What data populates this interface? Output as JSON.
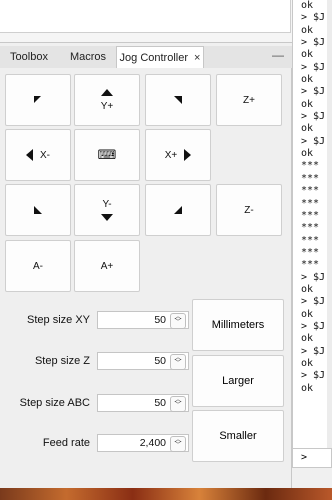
{
  "tabs": [
    {
      "label": "Toolbox"
    },
    {
      "label": "Macros"
    },
    {
      "label": "Jog Controller",
      "close": "×"
    }
  ],
  "minimize_glyph": "—",
  "jog": {
    "y_plus": "Y+",
    "z_plus": "Z+",
    "x_minus": "X-",
    "x_plus": "X+",
    "y_minus": "Y-",
    "z_minus": "Z-",
    "a_minus": "A-",
    "a_plus": "A+",
    "keyboard_glyph": "⌨"
  },
  "fields": [
    {
      "label": "Step size XY",
      "value": "50"
    },
    {
      "label": "Step size Z",
      "value": "50"
    },
    {
      "label": "Step size ABC",
      "value": "50"
    },
    {
      "label": "Feed rate",
      "value": "2,400"
    }
  ],
  "side_buttons": {
    "units": "Millimeters",
    "larger": "Larger",
    "smaller": "Smaller"
  },
  "console": {
    "lines": [
      "ok",
      "> $J",
      "ok",
      "> $J",
      "ok",
      "> $J",
      "ok",
      "> $J",
      "ok",
      "> $J",
      "ok",
      "> $J",
      "ok",
      "***",
      "***",
      "***",
      "***",
      "***",
      "***",
      "***",
      "***",
      "***",
      "> $J",
      "ok",
      "> $J",
      "ok",
      "> $J",
      "ok",
      "> $J",
      "ok",
      "> $J",
      "ok"
    ],
    "prompt": ">"
  }
}
